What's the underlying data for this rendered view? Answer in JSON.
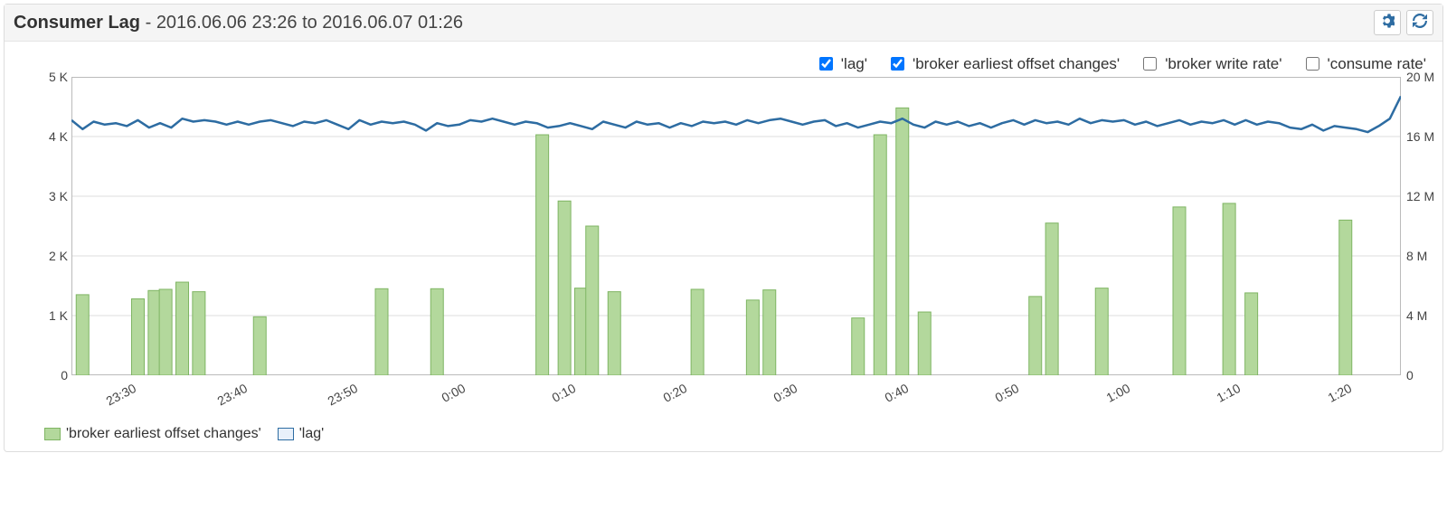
{
  "header": {
    "title_bold": "Consumer Lag",
    "title_sep": " - ",
    "title_range": "2016.06.06 23:26 to 2016.06.07 01:26"
  },
  "legend_top": [
    {
      "label": "'lag'",
      "checked": true
    },
    {
      "label": "'broker earliest offset changes'",
      "checked": true
    },
    {
      "label": "'broker write rate'",
      "checked": false
    },
    {
      "label": "'consume rate'",
      "checked": false
    }
  ],
  "legend_bottom": [
    {
      "label": "'broker earliest offset changes'",
      "swatch": "bar"
    },
    {
      "label": "'lag'",
      "swatch": "line"
    }
  ],
  "chart_data": {
    "type": "bar",
    "title": "Consumer Lag - 2016.06.06 23:26 to 2016.06.07 01:26",
    "xlabel": "",
    "y_left": {
      "label": "",
      "ticks": [
        "0",
        "1 K",
        "2 K",
        "3 K",
        "4 K",
        "5 K"
      ],
      "lim": [
        0,
        5000
      ]
    },
    "y_right": {
      "label": "",
      "ticks": [
        "0",
        "4 M",
        "8 M",
        "12 M",
        "16 M",
        "20 M"
      ],
      "lim": [
        0,
        20000000
      ]
    },
    "x_ticks": [
      "23:30",
      "23:40",
      "23:50",
      "0:00",
      "0:10",
      "0:20",
      "0:30",
      "0:40",
      "0:50",
      "1:00",
      "1:10",
      "1:20"
    ],
    "series": [
      {
        "name": "'broker earliest offset changes'",
        "kind": "bar",
        "axis": "left",
        "color_fill": "#b3d89c",
        "color_stroke": "#7fb563",
        "data": [
          {
            "t": "23:27",
            "v": 1350
          },
          {
            "t": "23:32",
            "v": 1280
          },
          {
            "t": "23:33.5",
            "v": 1420
          },
          {
            "t": "23:34.5",
            "v": 1440
          },
          {
            "t": "23:36",
            "v": 1560
          },
          {
            "t": "23:37.5",
            "v": 1400
          },
          {
            "t": "23:43",
            "v": 980
          },
          {
            "t": "23:54",
            "v": 1450
          },
          {
            "t": "23:59",
            "v": 1450
          },
          {
            "t": "0:08.5",
            "v": 4030
          },
          {
            "t": "0:10.5",
            "v": 2920
          },
          {
            "t": "0:12",
            "v": 1460
          },
          {
            "t": "0:13",
            "v": 2500
          },
          {
            "t": "0:15",
            "v": 1400
          },
          {
            "t": "0:22.5",
            "v": 1440
          },
          {
            "t": "0:27.5",
            "v": 1260
          },
          {
            "t": "0:29",
            "v": 1430
          },
          {
            "t": "0:37",
            "v": 960
          },
          {
            "t": "0:39",
            "v": 4030
          },
          {
            "t": "0:41",
            "v": 4480
          },
          {
            "t": "0:43",
            "v": 1060
          },
          {
            "t": "0:53",
            "v": 1320
          },
          {
            "t": "0:54.5",
            "v": 2550
          },
          {
            "t": "0:59",
            "v": 1460
          },
          {
            "t": "1:06",
            "v": 2820
          },
          {
            "t": "1:10.5",
            "v": 2880
          },
          {
            "t": "1:12.5",
            "v": 1380
          },
          {
            "t": "1:21",
            "v": 2600
          }
        ]
      },
      {
        "name": "'lag'",
        "kind": "line",
        "axis": "right",
        "color_stroke": "#2d6ca2",
        "data": [
          {
            "t": "23:26",
            "v": 17100000
          },
          {
            "t": "23:27",
            "v": 16500000
          },
          {
            "t": "23:28",
            "v": 17000000
          },
          {
            "t": "23:29",
            "v": 16800000
          },
          {
            "t": "23:30",
            "v": 16900000
          },
          {
            "t": "23:31",
            "v": 16700000
          },
          {
            "t": "23:32",
            "v": 17100000
          },
          {
            "t": "23:33",
            "v": 16600000
          },
          {
            "t": "23:34",
            "v": 16900000
          },
          {
            "t": "23:35",
            "v": 16600000
          },
          {
            "t": "23:36",
            "v": 17200000
          },
          {
            "t": "23:37",
            "v": 17000000
          },
          {
            "t": "23:38",
            "v": 17100000
          },
          {
            "t": "23:39",
            "v": 17000000
          },
          {
            "t": "23:40",
            "v": 16800000
          },
          {
            "t": "23:41",
            "v": 17000000
          },
          {
            "t": "23:42",
            "v": 16800000
          },
          {
            "t": "23:43",
            "v": 17000000
          },
          {
            "t": "23:44",
            "v": 17100000
          },
          {
            "t": "23:45",
            "v": 16900000
          },
          {
            "t": "23:46",
            "v": 16700000
          },
          {
            "t": "23:47",
            "v": 17000000
          },
          {
            "t": "23:48",
            "v": 16900000
          },
          {
            "t": "23:49",
            "v": 17100000
          },
          {
            "t": "23:50",
            "v": 16800000
          },
          {
            "t": "23:51",
            "v": 16500000
          },
          {
            "t": "23:52",
            "v": 17100000
          },
          {
            "t": "23:53",
            "v": 16800000
          },
          {
            "t": "23:54",
            "v": 17000000
          },
          {
            "t": "23:55",
            "v": 16900000
          },
          {
            "t": "23:56",
            "v": 17000000
          },
          {
            "t": "23:57",
            "v": 16800000
          },
          {
            "t": "23:58",
            "v": 16400000
          },
          {
            "t": "23:59",
            "v": 16900000
          },
          {
            "t": "0:00",
            "v": 16700000
          },
          {
            "t": "0:01",
            "v": 16800000
          },
          {
            "t": "0:02",
            "v": 17100000
          },
          {
            "t": "0:03",
            "v": 17000000
          },
          {
            "t": "0:04",
            "v": 17200000
          },
          {
            "t": "0:05",
            "v": 17000000
          },
          {
            "t": "0:06",
            "v": 16800000
          },
          {
            "t": "0:07",
            "v": 17000000
          },
          {
            "t": "0:08",
            "v": 16900000
          },
          {
            "t": "0:09",
            "v": 16600000
          },
          {
            "t": "0:10",
            "v": 16700000
          },
          {
            "t": "0:11",
            "v": 16900000
          },
          {
            "t": "0:12",
            "v": 16700000
          },
          {
            "t": "0:13",
            "v": 16500000
          },
          {
            "t": "0:14",
            "v": 17000000
          },
          {
            "t": "0:15",
            "v": 16800000
          },
          {
            "t": "0:16",
            "v": 16600000
          },
          {
            "t": "0:17",
            "v": 17000000
          },
          {
            "t": "0:18",
            "v": 16800000
          },
          {
            "t": "0:19",
            "v": 16900000
          },
          {
            "t": "0:20",
            "v": 16600000
          },
          {
            "t": "0:21",
            "v": 16900000
          },
          {
            "t": "0:22",
            "v": 16700000
          },
          {
            "t": "0:23",
            "v": 17000000
          },
          {
            "t": "0:24",
            "v": 16900000
          },
          {
            "t": "0:25",
            "v": 17000000
          },
          {
            "t": "0:26",
            "v": 16800000
          },
          {
            "t": "0:27",
            "v": 17100000
          },
          {
            "t": "0:28",
            "v": 16900000
          },
          {
            "t": "0:29",
            "v": 17100000
          },
          {
            "t": "0:30",
            "v": 17200000
          },
          {
            "t": "0:31",
            "v": 17000000
          },
          {
            "t": "0:32",
            "v": 16800000
          },
          {
            "t": "0:33",
            "v": 17000000
          },
          {
            "t": "0:34",
            "v": 17100000
          },
          {
            "t": "0:35",
            "v": 16700000
          },
          {
            "t": "0:36",
            "v": 16900000
          },
          {
            "t": "0:37",
            "v": 16600000
          },
          {
            "t": "0:38",
            "v": 16800000
          },
          {
            "t": "0:39",
            "v": 17000000
          },
          {
            "t": "0:40",
            "v": 16900000
          },
          {
            "t": "0:41",
            "v": 17200000
          },
          {
            "t": "0:42",
            "v": 16800000
          },
          {
            "t": "0:43",
            "v": 16600000
          },
          {
            "t": "0:44",
            "v": 17000000
          },
          {
            "t": "0:45",
            "v": 16800000
          },
          {
            "t": "0:46",
            "v": 17000000
          },
          {
            "t": "0:47",
            "v": 16700000
          },
          {
            "t": "0:48",
            "v": 16900000
          },
          {
            "t": "0:49",
            "v": 16600000
          },
          {
            "t": "0:50",
            "v": 16900000
          },
          {
            "t": "0:51",
            "v": 17100000
          },
          {
            "t": "0:52",
            "v": 16800000
          },
          {
            "t": "0:53",
            "v": 17100000
          },
          {
            "t": "0:54",
            "v": 16900000
          },
          {
            "t": "0:55",
            "v": 17000000
          },
          {
            "t": "0:56",
            "v": 16800000
          },
          {
            "t": "0:57",
            "v": 17200000
          },
          {
            "t": "0:58",
            "v": 16900000
          },
          {
            "t": "0:59",
            "v": 17100000
          },
          {
            "t": "1:00",
            "v": 17000000
          },
          {
            "t": "1:01",
            "v": 17100000
          },
          {
            "t": "1:02",
            "v": 16800000
          },
          {
            "t": "1:03",
            "v": 17000000
          },
          {
            "t": "1:04",
            "v": 16700000
          },
          {
            "t": "1:05",
            "v": 16900000
          },
          {
            "t": "1:06",
            "v": 17100000
          },
          {
            "t": "1:07",
            "v": 16800000
          },
          {
            "t": "1:08",
            "v": 17000000
          },
          {
            "t": "1:09",
            "v": 16900000
          },
          {
            "t": "1:10",
            "v": 17100000
          },
          {
            "t": "1:11",
            "v": 16800000
          },
          {
            "t": "1:12",
            "v": 17100000
          },
          {
            "t": "1:13",
            "v": 16800000
          },
          {
            "t": "1:14",
            "v": 17000000
          },
          {
            "t": "1:15",
            "v": 16900000
          },
          {
            "t": "1:16",
            "v": 16600000
          },
          {
            "t": "1:17",
            "v": 16500000
          },
          {
            "t": "1:18",
            "v": 16800000
          },
          {
            "t": "1:19",
            "v": 16400000
          },
          {
            "t": "1:20",
            "v": 16700000
          },
          {
            "t": "1:21",
            "v": 16600000
          },
          {
            "t": "1:22",
            "v": 16500000
          },
          {
            "t": "1:23",
            "v": 16300000
          },
          {
            "t": "1:24",
            "v": 16700000
          },
          {
            "t": "1:25",
            "v": 17200000
          },
          {
            "t": "1:26",
            "v": 18700000
          }
        ]
      }
    ]
  }
}
